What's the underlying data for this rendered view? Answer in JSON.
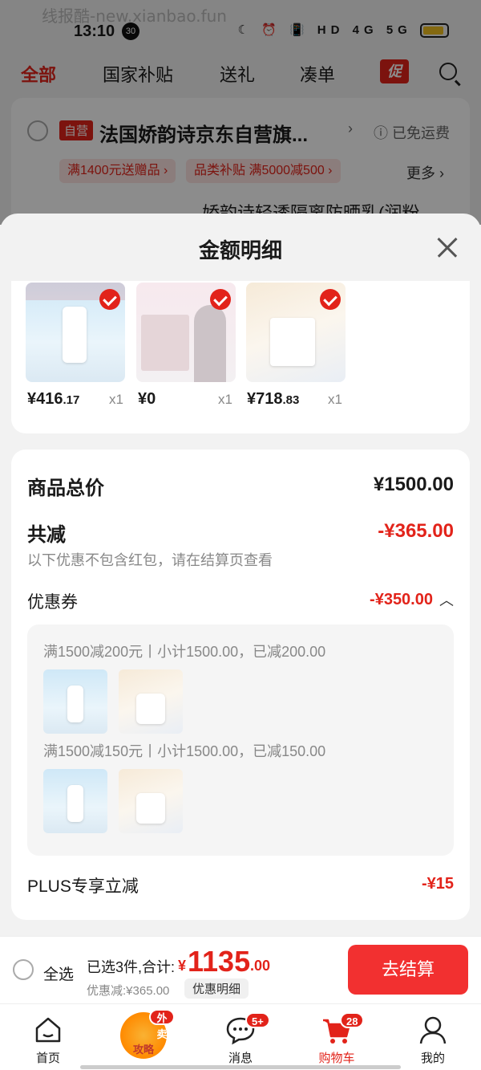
{
  "status_bar": {
    "watermark": "线报酷-new.xianbao.fun",
    "time": "13:10",
    "time_badge": "30",
    "icons": "☾ ⏰ 📳 HD 4G 5G"
  },
  "top_tabs": {
    "items": [
      "全部",
      "国家补贴",
      "送礼",
      "凑单"
    ],
    "promo": "促"
  },
  "store": {
    "self_tag": "自营",
    "name": "法国娇韵诗京东自营旗...",
    "arrow": "›",
    "shipping": "ⓘ 已免运费",
    "promo1": "满1400元送赠品 ›",
    "promo2": "品类补贴  满5000减500 ›",
    "more": "更多 ›",
    "next_item_title": "娇韵诗轻透隔离防晒乳(润粉"
  },
  "sheet": {
    "title": "金额明细",
    "products": [
      {
        "price_int": "¥416",
        "price_dec": ".17",
        "qty": "x1"
      },
      {
        "price_int": "¥0",
        "price_dec": "",
        "qty": "x1"
      },
      {
        "price_int": "¥718",
        "price_dec": ".83",
        "qty": "x1"
      }
    ],
    "total_label": "商品总价",
    "total_value": "¥1500.00",
    "discount_label": "共减",
    "discount_value": "-¥365.00",
    "discount_note": "以下优惠不包含红包，请在结算页查看",
    "coupon_label": "优惠券",
    "coupon_value": "-¥350.00",
    "coupon_lines": [
      "满1500减200元丨小计1500.00，已减200.00",
      "满1500减150元丨小计1500.00，已减150.00"
    ],
    "plus_label": "PLUS专享立减",
    "plus_value": "-¥15"
  },
  "checkout": {
    "select_all": "全选",
    "summary": "已选3件,合计:",
    "total_symbol": "¥",
    "total_int": "1135",
    "total_dec": ".00",
    "saved": "优惠减:¥365.00",
    "detail_button": "优惠明细",
    "pay_button": "去结算"
  },
  "tabbar": {
    "items": [
      {
        "label": "首页"
      },
      {
        "label": "攻略",
        "badge": "外卖"
      },
      {
        "label": "消息",
        "badge": "5+"
      },
      {
        "label": "购物车",
        "badge": "28"
      },
      {
        "label": "我的"
      }
    ]
  },
  "colors": {
    "accent": "#e2231a",
    "pay_button": "#f23030",
    "background": "#f2f2f2"
  }
}
